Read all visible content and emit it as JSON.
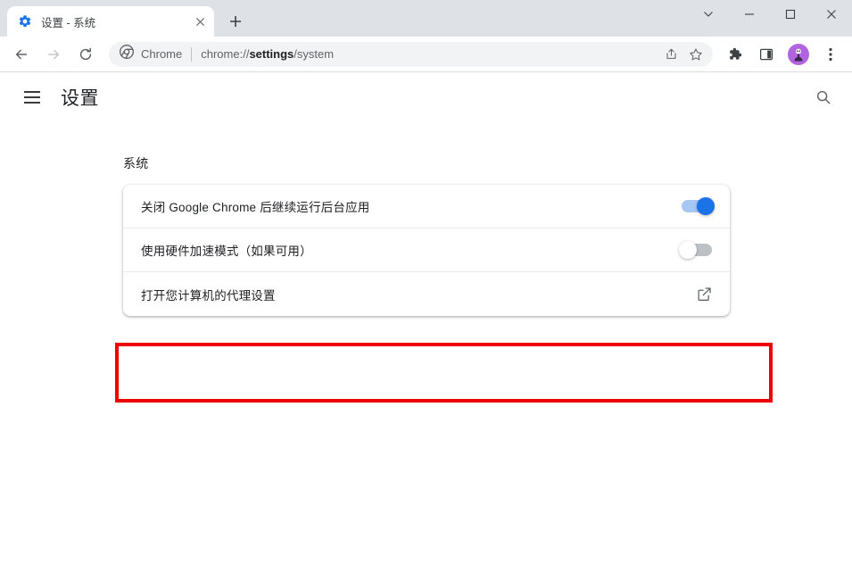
{
  "browser": {
    "tab": {
      "title": "设置 - 系统",
      "favicon": "gear-icon",
      "close_label": "✕"
    },
    "new_tab_label": "+",
    "window_controls": {
      "tab_search": "tab-search-chevron",
      "minimize": "—",
      "maximize": "▢",
      "close": "✕"
    },
    "toolbar": {
      "back": "back-arrow",
      "forward": "forward-arrow",
      "reload": "reload-arrow",
      "chrome_label": "Chrome",
      "url_prefix": "chrome://",
      "url_bold": "settings",
      "url_suffix": "/system",
      "url_full": "chrome://settings/system",
      "share": "share-icon",
      "bookmark": "star-icon",
      "extensions": "puzzle-icon",
      "side_panel": "side-panel-icon",
      "profile": "avatar-icon",
      "menu": "three-dot-menu-icon"
    }
  },
  "settings": {
    "menu_label": "hamburger-menu",
    "title": "设置",
    "search_label": "search-icon",
    "section": {
      "label": "系统",
      "rows": [
        {
          "label": "关闭 Google Chrome 后继续运行后台应用",
          "control": "toggle",
          "state": "on"
        },
        {
          "label": "使用硬件加速模式（如果可用）",
          "control": "toggle",
          "state": "off"
        },
        {
          "label": "打开您计算机的代理设置",
          "control": "external-link",
          "state": "link"
        }
      ]
    }
  },
  "annotation": {
    "color": "#ee0000",
    "target": "打开您计算机的代理设置"
  }
}
